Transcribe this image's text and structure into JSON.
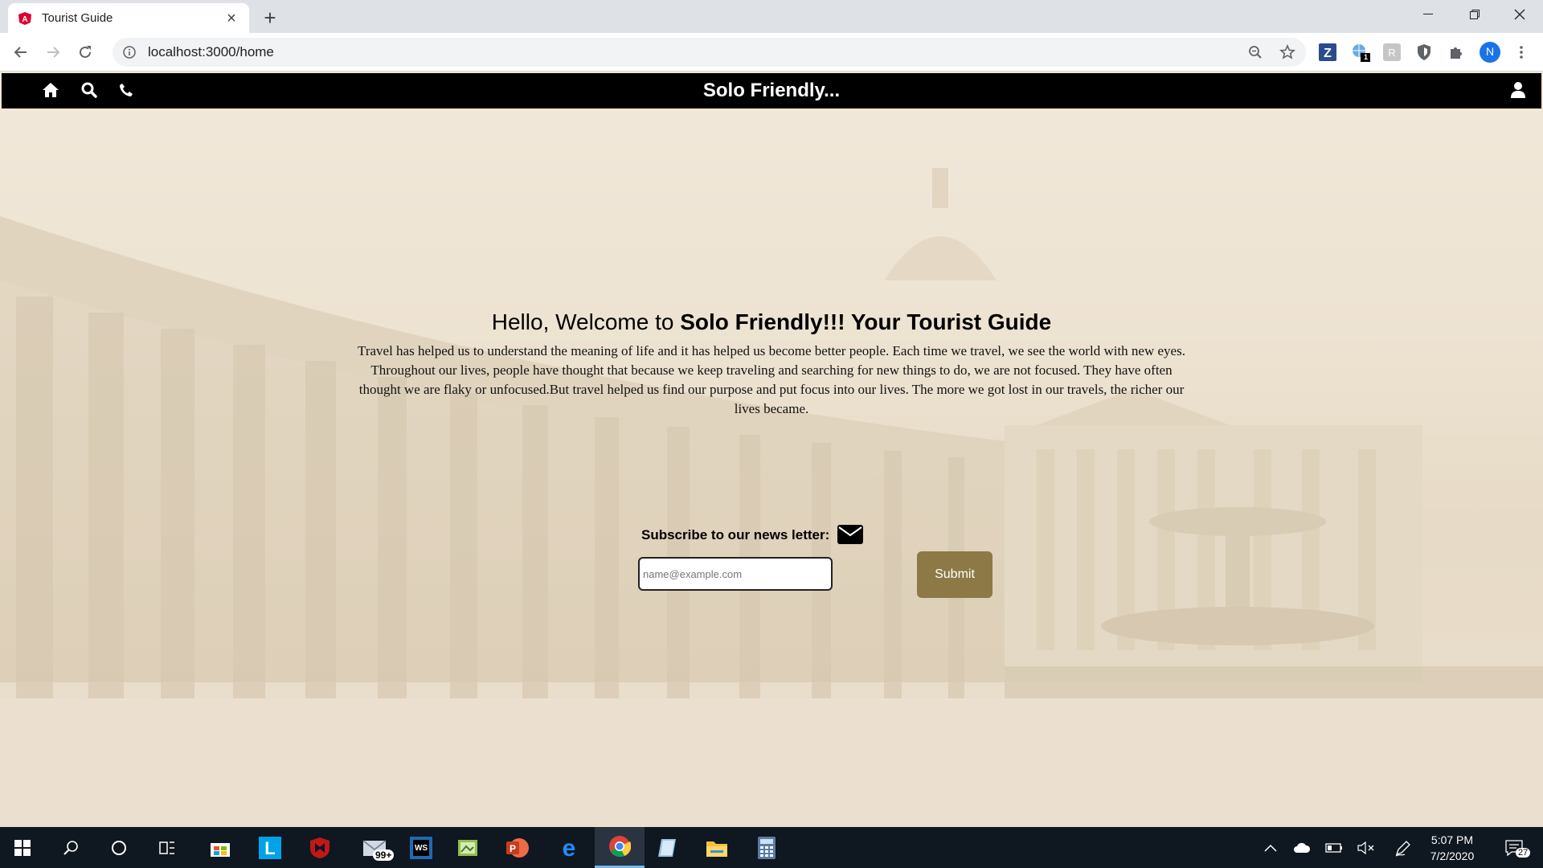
{
  "browser": {
    "tab_title": "Tourist Guide",
    "url": "localhost:3000/home",
    "profile_initial": "N",
    "extension_badge": "1"
  },
  "page": {
    "brand": "Solo Friendly...",
    "hero_title_prefix": "Hello, Welcome to ",
    "hero_title_bold": "Solo Friendly!!! Your Tourist Guide",
    "hero_text": "Travel has helped us to understand the meaning of life and it has helped us become better people. Each time we travel, we see the world with new eyes. Throughout our lives, people have thought that because we keep traveling and searching for new things to do, we are not focused. They have often thought we are flaky or unfocused.But travel helped us find our purpose and put focus into our lives. The more we got lost in our travels, the richer our lives became.",
    "subscribe_label": "Subscribe to our news letter:",
    "email_placeholder": "name@example.com",
    "submit_label": "Submit",
    "accent_color": "#8d7945"
  },
  "taskbar": {
    "mail_badge": "99+",
    "time": "5:07 PM",
    "date": "7/2/2020",
    "notification_count": "27"
  }
}
